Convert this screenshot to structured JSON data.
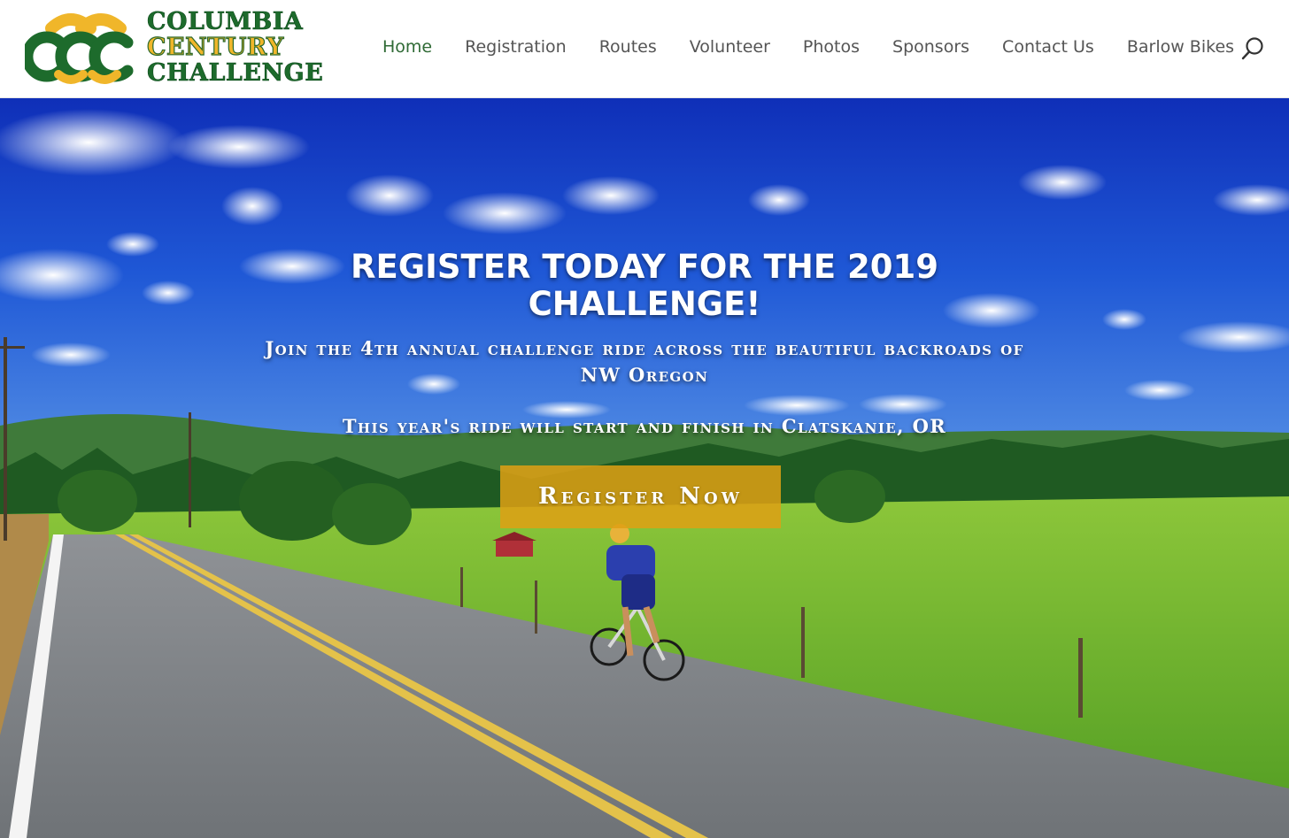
{
  "site": {
    "logo": {
      "line1": "COLUMBIA",
      "line2": "CENTURY",
      "line3": "CHALLENGE"
    }
  },
  "nav": {
    "items": [
      {
        "label": "Home",
        "active": true
      },
      {
        "label": "Registration",
        "active": false
      },
      {
        "label": "Routes",
        "active": false
      },
      {
        "label": "Volunteer",
        "active": false
      },
      {
        "label": "Photos",
        "active": false
      },
      {
        "label": "Sponsors",
        "active": false
      },
      {
        "label": "Contact Us",
        "active": false
      },
      {
        "label": "Barlow Bikes",
        "active": false
      }
    ],
    "search_icon": "search-icon"
  },
  "hero": {
    "title": "REGISTER TODAY FOR THE 2019 CHALLENGE!",
    "subtitle": "Join the 4th annual challenge ride across the beautiful backroads of NW Oregon",
    "subtitle2": "This year's ride will start and finish in Clatskanie, OR",
    "cta_label": "Register Now"
  },
  "colors": {
    "brand_green": "#1d6b2c",
    "brand_gold": "#f0b62a",
    "nav_active": "#2f6a35",
    "nav_text": "#555555",
    "cta_bg": "#dea014"
  }
}
